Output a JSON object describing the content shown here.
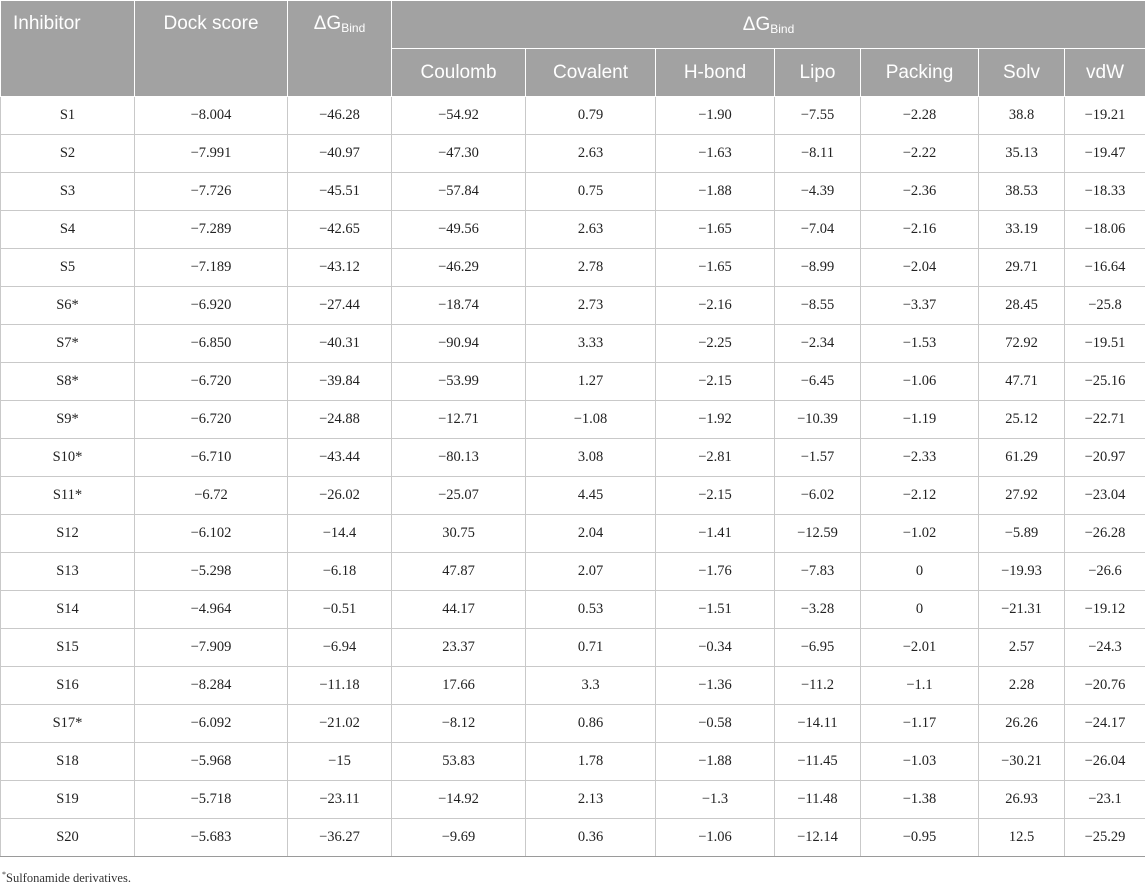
{
  "table": {
    "headers": {
      "inhibitor": "Inhibitor",
      "dock_score": "Dock score",
      "delta_g_bind": {
        "prefix": "ΔG",
        "sub": "Bind"
      },
      "group": {
        "prefix": "ΔG",
        "sub": "Bind"
      },
      "sub_columns": [
        "Coulomb",
        "Covalent",
        "H-bond",
        "Lipo",
        "Packing",
        "Solv",
        "vdW"
      ]
    },
    "rows": [
      [
        "S1",
        "−8.004",
        "−46.28",
        "−54.92",
        "0.79",
        "−1.90",
        "−7.55",
        "−2.28",
        "38.8",
        "−19.21"
      ],
      [
        "S2",
        "−7.991",
        "−40.97",
        "−47.30",
        "2.63",
        "−1.63",
        "−8.11",
        "−2.22",
        "35.13",
        "−19.47"
      ],
      [
        "S3",
        "−7.726",
        "−45.51",
        "−57.84",
        "0.75",
        "−1.88",
        "−4.39",
        "−2.36",
        "38.53",
        "−18.33"
      ],
      [
        "S4",
        "−7.289",
        "−42.65",
        "−49.56",
        "2.63",
        "−1.65",
        "−7.04",
        "−2.16",
        "33.19",
        "−18.06"
      ],
      [
        "S5",
        "−7.189",
        "−43.12",
        "−46.29",
        "2.78",
        "−1.65",
        "−8.99",
        "−2.04",
        "29.71",
        "−16.64"
      ],
      [
        "S6*",
        "−6.920",
        "−27.44",
        "−18.74",
        "2.73",
        "−2.16",
        "−8.55",
        "−3.37",
        "28.45",
        "−25.8"
      ],
      [
        "S7*",
        "−6.850",
        "−40.31",
        "−90.94",
        "3.33",
        "−2.25",
        "−2.34",
        "−1.53",
        "72.92",
        "−19.51"
      ],
      [
        "S8*",
        "−6.720",
        "−39.84",
        "−53.99",
        "1.27",
        "−2.15",
        "−6.45",
        "−1.06",
        "47.71",
        "−25.16"
      ],
      [
        "S9*",
        "−6.720",
        "−24.88",
        "−12.71",
        "−1.08",
        "−1.92",
        "−10.39",
        "−1.19",
        "25.12",
        "−22.71"
      ],
      [
        "S10*",
        "−6.710",
        "−43.44",
        "−80.13",
        "3.08",
        "−2.81",
        "−1.57",
        "−2.33",
        "61.29",
        "−20.97"
      ],
      [
        "S11*",
        "−6.72",
        "−26.02",
        "−25.07",
        "4.45",
        "−2.15",
        "−6.02",
        "−2.12",
        "27.92",
        "−23.04"
      ],
      [
        "S12",
        "−6.102",
        "−14.4",
        "30.75",
        "2.04",
        "−1.41",
        "−12.59",
        "−1.02",
        "−5.89",
        "−26.28"
      ],
      [
        "S13",
        "−5.298",
        "−6.18",
        "47.87",
        "2.07",
        "−1.76",
        "−7.83",
        "0",
        "−19.93",
        "−26.6"
      ],
      [
        "S14",
        "−4.964",
        "−0.51",
        "44.17",
        "0.53",
        "−1.51",
        "−3.28",
        "0",
        "−21.31",
        "−19.12"
      ],
      [
        "S15",
        "−7.909",
        "−6.94",
        "23.37",
        "0.71",
        "−0.34",
        "−6.95",
        "−2.01",
        "2.57",
        "−24.3"
      ],
      [
        "S16",
        "−8.284",
        "−11.18",
        "17.66",
        "3.3",
        "−1.36",
        "−11.2",
        "−1.1",
        "2.28",
        "−20.76"
      ],
      [
        "S17*",
        "−6.092",
        "−21.02",
        "−8.12",
        "0.86",
        "−0.58",
        "−14.11",
        "−1.17",
        "26.26",
        "−24.17"
      ],
      [
        "S18",
        "−5.968",
        "−15",
        "53.83",
        "1.78",
        "−1.88",
        "−11.45",
        "−1.03",
        "−30.21",
        "−26.04"
      ],
      [
        "S19",
        "−5.718",
        "−23.11",
        "−14.92",
        "2.13",
        "−1.3",
        "−11.48",
        "−1.38",
        "26.93",
        "−23.1"
      ],
      [
        "S20",
        "−5.683",
        "−36.27",
        "−9.69",
        "0.36",
        "−1.06",
        "−12.14",
        "−0.95",
        "12.5",
        "−25.29"
      ]
    ]
  },
  "footnote": {
    "marker": "*",
    "text": "Sulfonamide derivatives."
  }
}
